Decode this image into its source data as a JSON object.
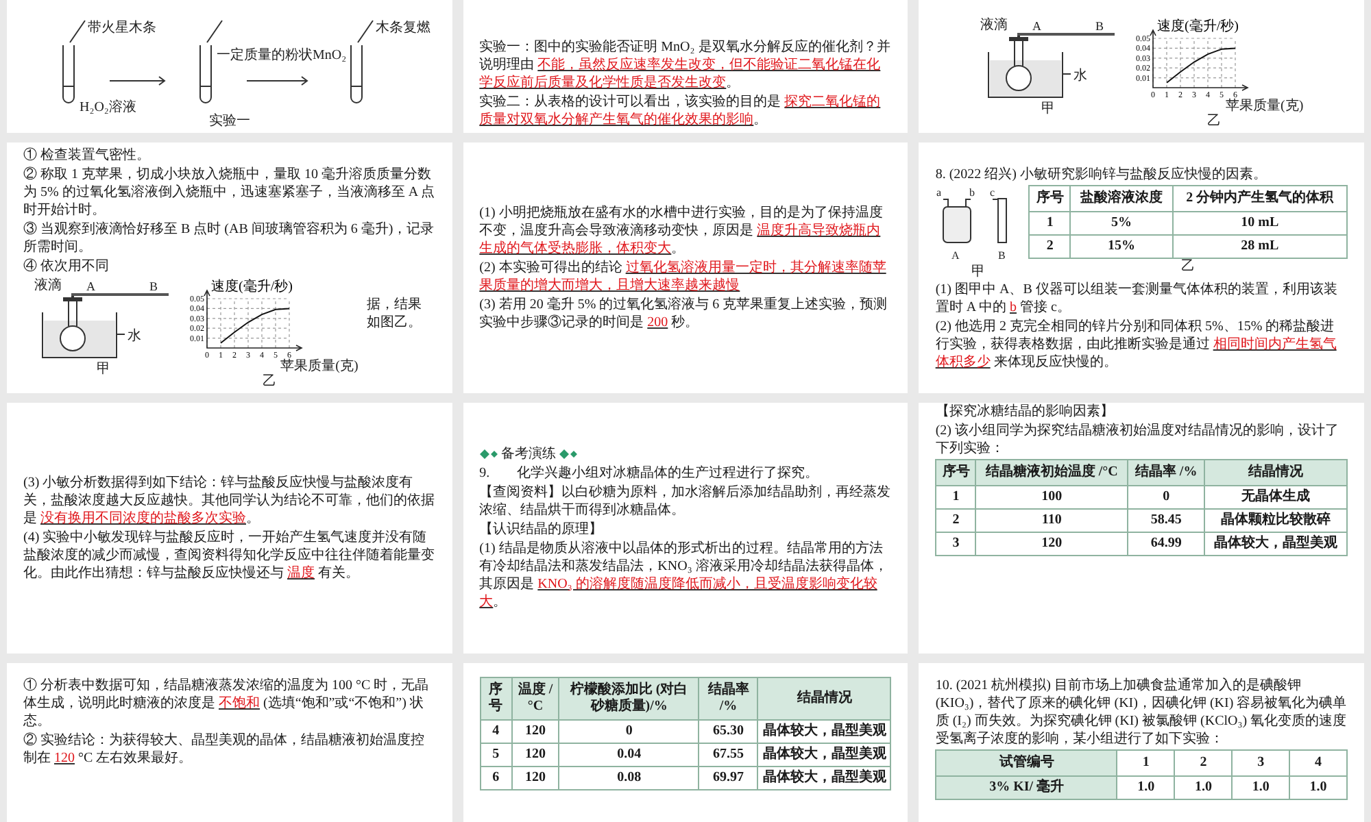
{
  "slides": [
    {
      "blocks": [
        {
          "kind": "test-tubes",
          "labels": [
            "带火星木条",
            "一定质量的粉状MnO₂",
            "木条复燃",
            "H₂O₂溶液"
          ],
          "caption": "实验一"
        }
      ]
    },
    {
      "blocks": [
        {
          "kind": "text",
          "parts": [
            {
              "kind": "plain",
              "text": "实验一：图中的实验能否证明 MnO₂ 是双氧水分解反应的催化剂？并说明理由 "
            },
            {
              "kind": "answer",
              "text": "不能，虽然反应速率发生改变，但不能验证二氧化锰在化学反应前后质量及化学性质是否发生改变"
            },
            {
              "kind": "plain",
              "text": "。"
            }
          ]
        },
        {
          "kind": "text",
          "parts": [
            {
              "kind": "plain",
              "text": "实验二：从表格的设计可以看出，该实验的目的是 "
            },
            {
              "kind": "answer",
              "text": "探究二氧化锰的质量对双氧水分解产生氧气的催化效果的影响"
            },
            {
              "kind": "plain",
              "text": "。"
            }
          ]
        }
      ]
    },
    {
      "blocks": [
        {
          "kind": "row",
          "children": [
            {
              "kind": "flask",
              "labels": [
                "液滴",
                "A",
                "B",
                "水"
              ],
              "caption": "甲"
            },
            {
              "kind": "chart",
              "caption": "乙",
              "chart_data": {
                "type": "line",
                "grid": true,
                "xlabel": "苹果质量(克)",
                "ylabel": "速度(毫升/秒)",
                "x": [
                  1,
                  2,
                  3,
                  4,
                  5,
                  6
                ],
                "series": [
                  {
                    "color": "#111111",
                    "values": [
                      0.005,
                      0.016,
                      0.026,
                      0.034,
                      0.039,
                      0.04
                    ]
                  }
                ],
                "xlim": [
                  0,
                  6
                ],
                "ylim": [
                  0,
                  0.05
                ],
                "xticks": [
                  {
                    "value": 0,
                    "label": "0"
                  },
                  {
                    "value": 1,
                    "label": "1"
                  },
                  {
                    "value": 2,
                    "label": "2"
                  },
                  {
                    "value": 3,
                    "label": "3"
                  },
                  {
                    "value": 4,
                    "label": "4"
                  },
                  {
                    "value": 5,
                    "label": "5"
                  },
                  {
                    "value": 6,
                    "label": "6"
                  }
                ],
                "yticks": [
                  {
                    "value": 0.01,
                    "label": "0.01"
                  },
                  {
                    "value": 0.02,
                    "label": "0.02"
                  },
                  {
                    "value": 0.03,
                    "label": "0.03"
                  },
                  {
                    "value": 0.04,
                    "label": "0.04"
                  },
                  {
                    "value": 0.05,
                    "label": "0.05"
                  }
                ]
              }
            }
          ]
        }
      ]
    },
    {
      "blocks": [
        {
          "kind": "text",
          "parts": [
            {
              "kind": "plain",
              "text": "① 检查装置气密性。"
            }
          ]
        },
        {
          "kind": "text",
          "parts": [
            {
              "kind": "plain",
              "text": "② 称取 1 克苹果，切成小块放入烧瓶中，量取 10 毫升溶质质量分数为 5% 的过氧化氢溶液倒入烧瓶中，迅速塞紧塞子，当液滴移至 A 点时开始计时。"
            }
          ]
        },
        {
          "kind": "text",
          "parts": [
            {
              "kind": "plain",
              "text": "③ 当观察到液滴恰好移至 B 点时 (AB 间玻璃管容积为 6 毫升)，记录所需时间。"
            }
          ]
        },
        {
          "kind": "text",
          "parts": [
            {
              "kind": "plain",
              "text": "④ 依次用不同"
            }
          ]
        },
        {
          "kind": "row",
          "children": [
            {
              "kind": "flask",
              "labels": [
                "液滴",
                "A",
                "B",
                "水"
              ],
              "caption": "甲"
            },
            {
              "kind": "chart",
              "caption": "乙",
              "chart_data": {
                "type": "line",
                "grid": true,
                "xlabel": "苹果质量(克)",
                "ylabel": "速度(毫升/秒)",
                "x": [
                  1,
                  2,
                  3,
                  4,
                  5,
                  6
                ],
                "series": [
                  {
                    "color": "#111111",
                    "values": [
                      0.005,
                      0.016,
                      0.026,
                      0.034,
                      0.039,
                      0.04
                    ]
                  }
                ],
                "xlim": [
                  0,
                  6
                ],
                "ylim": [
                  0,
                  0.05
                ],
                "xticks": [
                  {
                    "value": 0,
                    "label": "0"
                  },
                  {
                    "value": 1,
                    "label": "1"
                  },
                  {
                    "value": 2,
                    "label": "2"
                  },
                  {
                    "value": 3,
                    "label": "3"
                  },
                  {
                    "value": 4,
                    "label": "4"
                  },
                  {
                    "value": 5,
                    "label": "5"
                  },
                  {
                    "value": 6,
                    "label": "6"
                  }
                ],
                "yticks": [
                  {
                    "value": 0.01,
                    "label": "0.01"
                  },
                  {
                    "value": 0.02,
                    "label": "0.02"
                  },
                  {
                    "value": 0.03,
                    "label": "0.03"
                  },
                  {
                    "value": 0.04,
                    "label": "0.04"
                  },
                  {
                    "value": 0.05,
                    "label": "0.05"
                  }
                ]
              }
            },
            {
              "kind": "text",
              "parts": [
                {
                  "kind": "plain",
                  "text": "据，结果如图乙。"
                }
              ]
            }
          ]
        }
      ]
    },
    {
      "blocks": [
        {
          "kind": "text",
          "parts": [
            {
              "kind": "plain",
              "text": "(1) 小明把烧瓶放在盛有水的水槽中进行实验，目的是为了保持温度不变，温度升高会导致液滴移动变快，原因是 "
            },
            {
              "kind": "answer",
              "text": "温度升高导致烧瓶内生成的气体受热膨胀，体积变大"
            },
            {
              "kind": "plain",
              "text": "。"
            }
          ]
        },
        {
          "kind": "text",
          "parts": [
            {
              "kind": "plain",
              "text": "(2) 本实验可得出的结论 "
            },
            {
              "kind": "answer",
              "text": "过氧化氢溶液用量一定时，其分解速率随苹果质量的增大而增大，且增大速率越来越慢"
            }
          ]
        },
        {
          "kind": "text",
          "parts": [
            {
              "kind": "plain",
              "text": "(3) 若用 20 毫升 5% 的过氧化氢溶液与 6 克苹果重复上述实验，预测实验中步骤③记录的时间是 "
            },
            {
              "kind": "answer",
              "text": "200"
            },
            {
              "kind": "plain",
              "text": " 秒。"
            }
          ]
        }
      ]
    },
    {
      "blocks": [
        {
          "kind": "text",
          "parts": [
            {
              "kind": "plain",
              "text": "8. (2022 绍兴) 小敏研究影响锌与盐酸反应快慢的因素。"
            }
          ]
        },
        {
          "kind": "row",
          "children": [
            {
              "kind": "gas-bottle",
              "labels": [
                "a",
                "b",
                "c",
                "A",
                "B"
              ],
              "caption": "甲"
            },
            {
              "kind": "plain-table",
              "caption": "乙",
              "columns": [
                "序号",
                "盐酸溶液浓度",
                "2 分钟内产生氢气的体积"
              ],
              "rows": [
                [
                  "1",
                  "5%",
                  "10 mL"
                ],
                [
                  "2",
                  "15%",
                  "28 mL"
                ]
              ]
            }
          ]
        },
        {
          "kind": "text",
          "parts": [
            {
              "kind": "plain",
              "text": "(1) 图甲中 A、B 仪器可以组装一套测量气体体积的装置，利用该装置时 A 中的 "
            },
            {
              "kind": "answer",
              "text": "b"
            },
            {
              "kind": "plain",
              "text": " 管接 c。"
            }
          ]
        },
        {
          "kind": "text",
          "parts": [
            {
              "kind": "plain",
              "text": "(2) 他选用 2 克完全相同的锌片分别和同体积 5%、15% 的稀盐酸进行实验，获得表格数据，由此推断实验是通过 "
            },
            {
              "kind": "answer",
              "text": "相同时间内产生氢气体积多少"
            },
            {
              "kind": "plain",
              "text": " 来体现反应快慢的。"
            }
          ]
        }
      ]
    },
    {
      "blocks": [
        {
          "kind": "text",
          "parts": [
            {
              "kind": "plain",
              "text": "(3) 小敏分析数据得到如下结论：锌与盐酸反应快慢与盐酸浓度有关，盐酸浓度越大反应越快。其他同学认为结论不可靠，他们的依据是 "
            },
            {
              "kind": "answer",
              "text": "没有换用不同浓度的盐酸多次实验"
            },
            {
              "kind": "plain",
              "text": "。"
            }
          ]
        },
        {
          "kind": "text",
          "parts": [
            {
              "kind": "plain",
              "text": "(4) 实验中小敏发现锌与盐酸反应时，一开始产生氢气速度并没有随盐酸浓度的减少而减慢，查阅资料得知化学反应中往往伴随着能量变化。由此作出猜想：锌与盐酸反应快慢还与 "
            },
            {
              "kind": "answer",
              "text": "温度"
            },
            {
              "kind": "plain",
              "text": " 有关。"
            }
          ]
        }
      ]
    },
    {
      "blocks": [
        {
          "kind": "badge",
          "text": "备考演练"
        },
        {
          "kind": "text",
          "parts": [
            {
              "kind": "plain",
              "text": "9.　　化学兴趣小组对冰糖晶体的生产过程进行了探究。"
            }
          ]
        },
        {
          "kind": "text",
          "parts": [
            {
              "kind": "plain",
              "text": "【查阅资料】以白砂糖为原料，加水溶解后添加结晶助剂，再经蒸发浓缩、结晶烘干而得到冰糖晶体。"
            }
          ]
        },
        {
          "kind": "text",
          "parts": [
            {
              "kind": "plain",
              "text": "【认识结晶的原理】"
            }
          ]
        },
        {
          "kind": "text",
          "parts": [
            {
              "kind": "plain",
              "text": "(1) 结晶是物质从溶液中以晶体的形式析出的过程。结晶常用的方法有冷却结晶法和蒸发结晶法，KNO₃ 溶液采用冷却结晶法获得晶体，其原因是 "
            },
            {
              "kind": "answer",
              "text": "KNO₃ 的溶解度随温度降低而减小，且受温度影响变化较大"
            },
            {
              "kind": "plain",
              "text": "。"
            }
          ]
        }
      ]
    },
    {
      "blocks": [
        {
          "kind": "text",
          "parts": [
            {
              "kind": "plain",
              "text": "【探究冰糖结晶的影响因素】"
            }
          ]
        },
        {
          "kind": "text",
          "parts": [
            {
              "kind": "plain",
              "text": "(2) 该小组同学为探究结晶糖液初始温度对结晶情况的影响，设计了下列实验："
            }
          ]
        },
        {
          "kind": "table",
          "columns": [
            "序号",
            "结晶糖液初始温度 /°C",
            "结晶率 /%",
            "结晶情况"
          ],
          "rows": [
            [
              "1",
              "100",
              "0",
              "无晶体生成"
            ],
            [
              "2",
              "110",
              "58.45",
              "晶体颗粒比较散碎"
            ],
            [
              "3",
              "120",
              "64.99",
              "晶体较大，晶型美观"
            ]
          ]
        }
      ]
    },
    {
      "blocks": [
        {
          "kind": "text",
          "parts": [
            {
              "kind": "plain",
              "text": "① 分析表中数据可知，结晶糖液蒸发浓缩的温度为 100 °C 时，无晶体生成，说明此时糖液的浓度是 "
            },
            {
              "kind": "answer",
              "text": "不饱和"
            },
            {
              "kind": "plain",
              "text": " (选填“饱和”或“不饱和”) 状态。"
            }
          ]
        },
        {
          "kind": "text",
          "parts": [
            {
              "kind": "plain",
              "text": "② 实验结论：为获得较大、晶型美观的晶体，结晶糖液初始温度控制在 "
            },
            {
              "kind": "answer",
              "text": "120"
            },
            {
              "kind": "plain",
              "text": " °C 左右效果最好。"
            }
          ]
        }
      ]
    },
    {
      "blocks": [
        {
          "kind": "table",
          "columns": [
            "序号",
            "温度 /°C",
            "柠檬酸添加比 (对白砂糖质量)/%",
            "结晶率 /%",
            "结晶情况"
          ],
          "rows": [
            [
              "4",
              "120",
              "0",
              "65.30",
              "晶体较大，晶型美观"
            ],
            [
              "5",
              "120",
              "0.04",
              "67.55",
              "晶体较大，晶型美观"
            ],
            [
              "6",
              "120",
              "0.08",
              "69.97",
              "晶体较大，晶型美观"
            ]
          ]
        }
      ]
    },
    {
      "blocks": [
        {
          "kind": "text",
          "parts": [
            {
              "kind": "plain",
              "text": "10. (2021 杭州模拟) 目前市场上加碘食盐通常加入的是碘酸钾 (KIO₃)，替代了原来的碘化钾 (KI)，因碘化钾 (KI) 容易被氧化为碘单质 (I₂) 而失效。为探究碘化钾 (KI) 被氯酸钾 (KClO₃) 氧化变质的速度受氢离子浓度的影响，某小组进行了如下实验："
            }
          ]
        },
        {
          "kind": "side-table",
          "columns": [
            "试管编号",
            "1",
            "2",
            "3",
            "4"
          ],
          "rows": [
            [
              "3% KI/ 毫升",
              "1.0",
              "1.0",
              "1.0",
              "1.0"
            ]
          ]
        }
      ]
    }
  ]
}
